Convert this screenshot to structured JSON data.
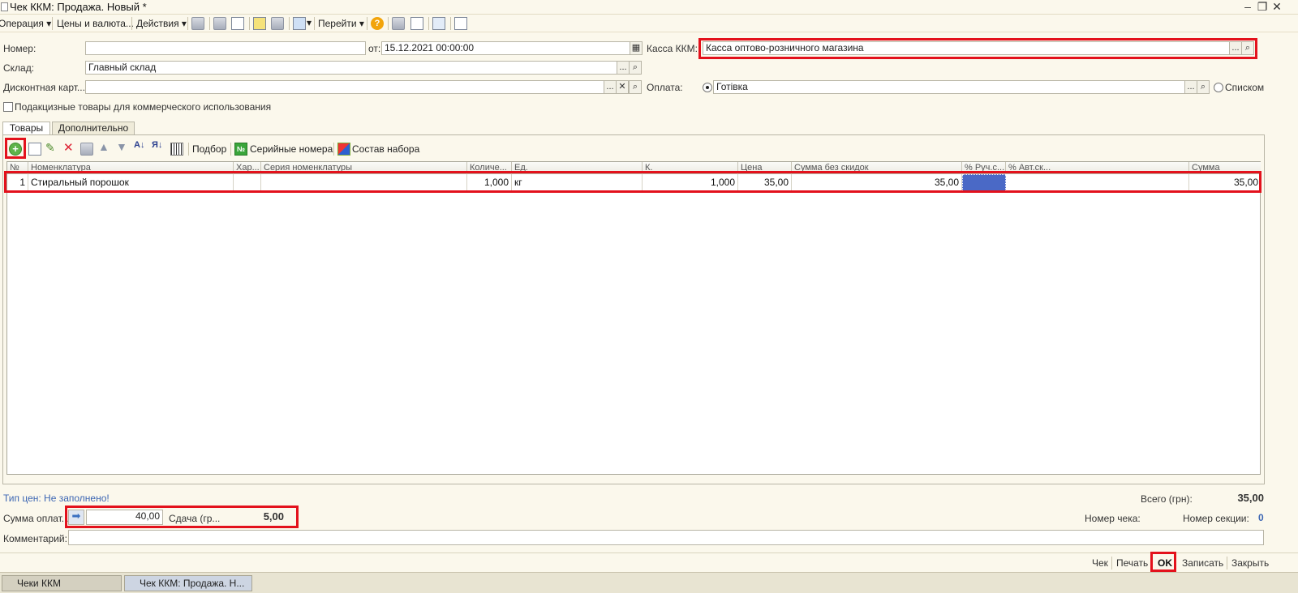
{
  "window": {
    "title": "Чек ККМ: Продажа. Новый *"
  },
  "toolbar": {
    "operation": "Операция",
    "prices": "Цены и валюта...",
    "actions": "Действия",
    "goto": "Перейти",
    "help": "?"
  },
  "form": {
    "number_label": "Номер:",
    "number_value": "",
    "date_label": "от:",
    "date_value": "15.12.2021 00:00:00",
    "kassa_label": "Касса ККМ:",
    "kassa_value": "Касса оптово-розничного магазина",
    "warehouse_label": "Склад:",
    "warehouse_value": "Главный склад",
    "discount_label": "Дисконтная карт...",
    "discount_value": "",
    "payment_label": "Оплата:",
    "payment_option_cash": "Готівка",
    "payment_option_list": "Списком",
    "excise_label": "Подакцизные товары для коммерческого использования",
    "select_dots": "...",
    "clear_x": "✕"
  },
  "tabs": [
    {
      "label": "Товары"
    },
    {
      "label": "Дополнительно"
    }
  ],
  "table_toolbar": {
    "pick": "Подбор",
    "serials": "Серийные номера",
    "kit": "Состав набора"
  },
  "table": {
    "columns": [
      "№",
      "Номенклатура",
      "Хар...",
      "Серия номенклатуры",
      "Количе...",
      "Ед.",
      "К.",
      "Цена",
      "Сумма без скидок",
      "% Руч.с...",
      "% Авт.ск...",
      "Сумма"
    ],
    "rows": [
      {
        "n": "1",
        "item": "Стиральный порошок",
        "char": "",
        "series": "",
        "qty": "1,000",
        "unit": "кг",
        "k": "1,000",
        "price": "35,00",
        "sum_no_disc": "35,00",
        "manual_disc": "",
        "auto_disc": "",
        "sum": "35,00"
      }
    ]
  },
  "footer": {
    "price_type": "Тип цен: Не заполнено!",
    "total_label": "Всего (грн):",
    "total_value": "35,00",
    "paid_label": "Сумма оплат...",
    "paid_value": "40,00",
    "change_label": "Сдача (гр...",
    "change_value": "5,00",
    "check_number_label": "Номер чека:",
    "section_label": "Номер секции:",
    "section_value": "0",
    "comment_label": "Комментарий:",
    "comment_value": ""
  },
  "bottom_buttons": {
    "check": "Чек",
    "print": "Печать",
    "ok": "OK",
    "save": "Записать",
    "close": "Закрыть"
  },
  "taskbar": {
    "task1": "Чеки ККМ",
    "task2": "Чек ККМ: Продажа. Н..."
  },
  "colors": {
    "highlight": "#e3111c",
    "selected_cell": "#4a69c6",
    "link": "#3c66b3"
  }
}
